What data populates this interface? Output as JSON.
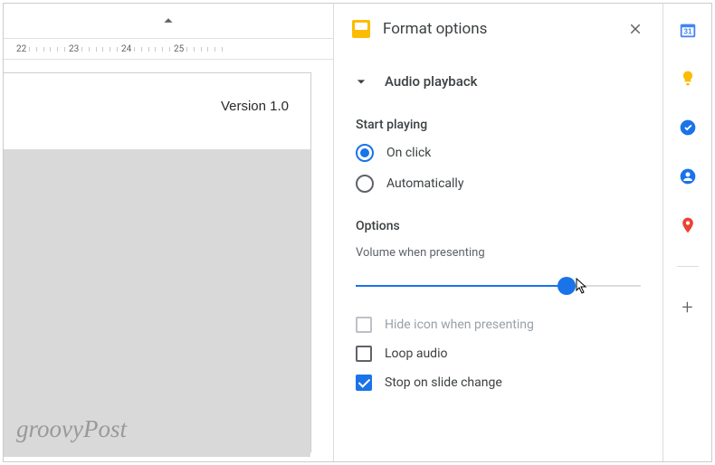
{
  "slide": {
    "version_text": "Version 1.0",
    "ruler_marks": [
      "22",
      "23",
      "24",
      "25"
    ]
  },
  "watermark": "groovyPost",
  "panel": {
    "title": "Format options",
    "section_title": "Audio playback",
    "start_playing_heading": "Start playing",
    "radio_on_click": "On click",
    "radio_automatically": "Automatically",
    "options_heading": "Options",
    "volume_hint": "Volume when presenting",
    "slider_percent": 74,
    "checkbox_hide_icon": "Hide icon when presenting",
    "checkbox_loop": "Loop audio",
    "checkbox_stop_change": "Stop on slide change"
  },
  "rail": {
    "calendar": "calendar-icon",
    "keep": "keep-icon",
    "tasks": "tasks-icon",
    "contacts": "contacts-icon",
    "maps": "maps-icon",
    "add": "add-icon"
  }
}
